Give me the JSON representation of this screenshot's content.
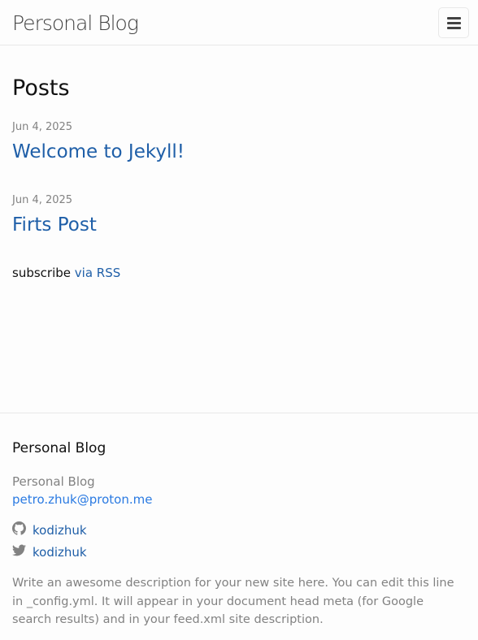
{
  "header": {
    "site_title": "Personal Blog",
    "menu_icon": "hamburger-menu-icon"
  },
  "main": {
    "heading": "Posts",
    "posts": [
      {
        "date": "Jun 4, 2025",
        "title": "Welcome to Jekyll!"
      },
      {
        "date": "Jun 4, 2025",
        "title": "Firts Post"
      }
    ],
    "rss": {
      "prefix": "subscribe",
      "link_label": "via RSS"
    }
  },
  "footer": {
    "heading": "Personal Blog",
    "name": "Personal Blog",
    "email": "petro.zhuk@proton.me",
    "social": [
      {
        "icon": "github-icon",
        "username": "kodizhuk"
      },
      {
        "icon": "twitter-icon",
        "username": "kodizhuk"
      }
    ],
    "description": "Write an awesome description for your new site here. You can edit this line in _config.yml. It will appear in your document head meta (for Google search results) and in your feed.xml site description."
  },
  "colors": {
    "link": "#1f5fa8",
    "muted_text": "#828282",
    "body_text": "#111111",
    "border": "#e8e8e8",
    "background": "#fdfdfd"
  }
}
